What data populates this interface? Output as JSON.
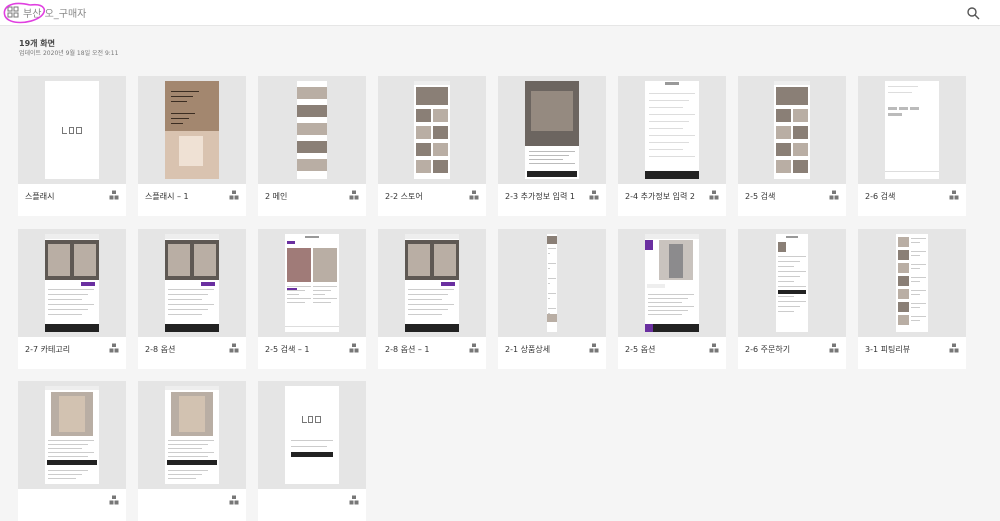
{
  "header": {
    "project_title": "부산 오_구매자",
    "screen_count": "19개 화면",
    "updated": "업데이트 2020년 9월 18일 오전 9:11"
  },
  "colors": {
    "accent": "#6a2fa0",
    "annotation": "#e040e0"
  },
  "icons": {
    "grid": "grid-icon",
    "search": "search-icon",
    "share": "share-icon"
  },
  "screens": [
    {
      "label": "스플래시",
      "style": "logo"
    },
    {
      "label": "스플래시 – 1",
      "style": "photo"
    },
    {
      "label": "2 메인",
      "style": "stack"
    },
    {
      "label": "2-2 스토어",
      "style": "feed"
    },
    {
      "label": "2-3 추가정보 입력 1",
      "style": "modal"
    },
    {
      "label": "2-4 추가정보 입력 2",
      "style": "form"
    },
    {
      "label": "2-5 검색",
      "style": "feed"
    },
    {
      "label": "2-6 검색",
      "style": "blank"
    },
    {
      "label": "2-7 카테고리",
      "style": "option"
    },
    {
      "label": "2-8 옵션",
      "style": "option"
    },
    {
      "label": "2-5 검색 – 1",
      "style": "search"
    },
    {
      "label": "2-8 옵션 – 1",
      "style": "option"
    },
    {
      "label": "2-1 상품상세",
      "style": "long"
    },
    {
      "label": "2-5 옵션",
      "style": "detail"
    },
    {
      "label": "2-6 주문하기",
      "style": "order"
    },
    {
      "label": "3-1 피팅리뷰",
      "style": "review"
    },
    {
      "label": "",
      "style": "product"
    },
    {
      "label": "",
      "style": "product"
    },
    {
      "label": "",
      "style": "login"
    }
  ]
}
